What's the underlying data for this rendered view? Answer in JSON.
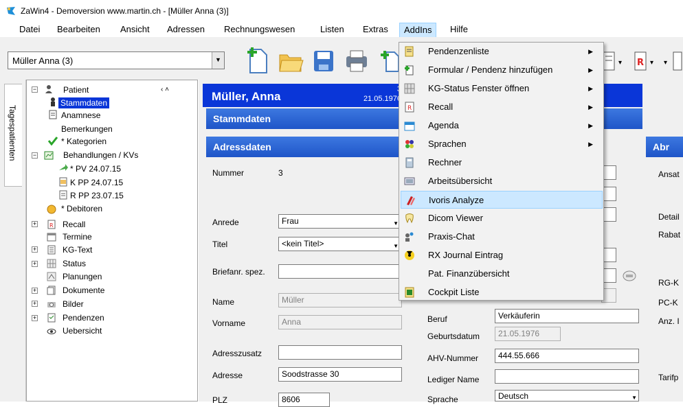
{
  "window": {
    "title": "ZaWin4 - Demoversion  www.martin.ch - [Müller Anna (3)]"
  },
  "menu": [
    "Datei",
    "Bearbeiten",
    "Ansicht",
    "Adressen",
    "Rechnungswesen",
    "Listen",
    "Extras",
    "AddIns",
    "Hilfe"
  ],
  "toolbar": {
    "patient_select": "Müller Anna (3)"
  },
  "sidetab": {
    "label": "Tagespatienten"
  },
  "tree": {
    "patient": "Patient",
    "stammdaten": "Stammdaten",
    "anamnese": "Anamnese",
    "bemerkungen": "Bemerkungen",
    "kategorien": "* Kategorien",
    "behandlungen": "Behandlungen / KVs",
    "pv": "*  PV 24.07.15",
    "kpp": "K  PP 24.07.15",
    "rpp": "R  PP 23.07.15",
    "debitoren": "* Debitoren",
    "recall": "Recall",
    "termine": "Termine",
    "kgtext": "KG-Text",
    "status": "Status",
    "planungen": "Planungen",
    "dokumente": "Dokumente",
    "bilder": "Bilder",
    "pendenzen": "Pendenzen",
    "uebersicht": "Uebersicht",
    "header_arrows": "‹  ˄"
  },
  "header": {
    "name": "Müller, Anna",
    "number": "3",
    "date": "21.05.1976"
  },
  "sections": {
    "stammdaten": "Stammdaten",
    "adressdaten": "Adressdaten",
    "abr": "Abr"
  },
  "form": {
    "nummer_label": "Nummer",
    "nummer_value": "3",
    "anrede_label": "Anrede",
    "anrede_value": "Frau",
    "titel_label": "Titel",
    "titel_value": "<kein Titel>",
    "briefanr_label": "Briefanr. spez.",
    "name_label": "Name",
    "name_value": "Müller",
    "vorname_label": "Vorname",
    "vorname_value": "Anna",
    "adresszusatz_label": "Adresszusatz",
    "adresse_label": "Adresse",
    "adresse_value": "Soodstrasse 30",
    "plz_label": "PLZ",
    "plz_value": "8606",
    "beruf_label": "Beruf",
    "beruf_value": "Verkäuferin",
    "geburtsdatum_label": "Geburtsdatum",
    "geburtsdatum_value": "21.05.1976",
    "ahv_label": "AHV-Nummer",
    "ahv_value": "444.55.666",
    "ledig_label": "Lediger Name",
    "sprache_label": "Sprache",
    "sprache_value": "Deutsch"
  },
  "right_labels": {
    "ansat": "Ansat",
    "detail": "Detail",
    "rabat": "Rabat",
    "rgk": "RG-K",
    "pck": "PC-K",
    "anz": "Anz. I",
    "tarif": "Tarifp"
  },
  "addins_menu": [
    {
      "label": "Pendenzenliste",
      "submenu": true,
      "icon": "list-icon"
    },
    {
      "label": "Formular / Pendenz hinzufügen",
      "submenu": true,
      "icon": "form-add-icon"
    },
    {
      "label": "KG-Status Fenster öffnen",
      "submenu": true,
      "icon": "status-grid-icon"
    },
    {
      "label": "Recall",
      "submenu": true,
      "icon": "recall-icon"
    },
    {
      "label": "Agenda",
      "submenu": true,
      "icon": "agenda-icon"
    },
    {
      "label": "Sprachen",
      "submenu": true,
      "icon": "languages-icon"
    },
    {
      "label": "Rechner",
      "submenu": false,
      "icon": "calculator-icon"
    },
    {
      "label": "Arbeitsübersicht",
      "submenu": false,
      "icon": "work-overview-icon"
    },
    {
      "label": "Ivoris Analyze",
      "submenu": false,
      "icon": "ivoris-icon"
    },
    {
      "label": "Dicom Viewer",
      "submenu": false,
      "icon": "tooth-icon"
    },
    {
      "label": "Praxis-Chat",
      "submenu": false,
      "icon": "chat-icon"
    },
    {
      "label": "RX Journal Eintrag",
      "submenu": false,
      "icon": "radiation-icon"
    },
    {
      "label": "Pat. Finanzübersicht",
      "submenu": false,
      "icon": "finance-icon"
    },
    {
      "label": "Cockpit Liste",
      "submenu": false,
      "icon": "cockpit-icon"
    }
  ],
  "colors": {
    "accent_blue": "#0a36d8",
    "section_blue": "#1f55c8",
    "highlight": "#cce8ff"
  }
}
